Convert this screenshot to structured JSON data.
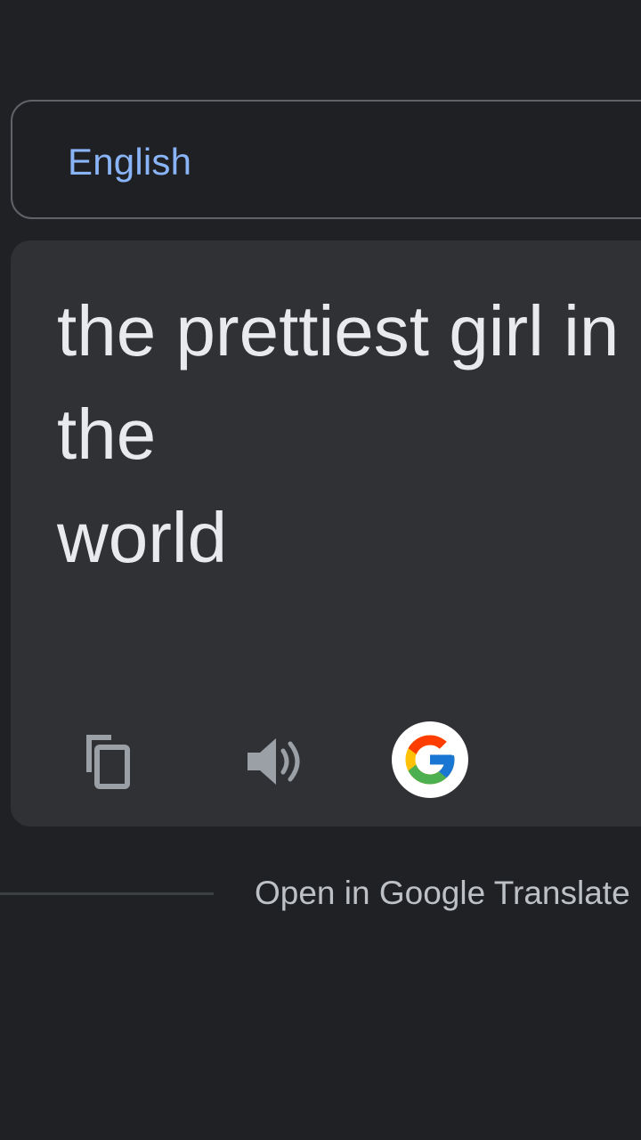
{
  "source_language": {
    "label": "English"
  },
  "translation": {
    "text": "the prettiest girl in the\nworld"
  },
  "actions": {
    "copy_icon": "copy-icon",
    "speaker_icon": "speaker-icon",
    "google_icon": "google-icon"
  },
  "footer": {
    "open_link": "Open in Google Translate"
  },
  "colors": {
    "background": "#202124",
    "card": "#303134",
    "accent": "#8ab4f8",
    "text": "#e8eaed",
    "muted": "#bdc1c6"
  }
}
